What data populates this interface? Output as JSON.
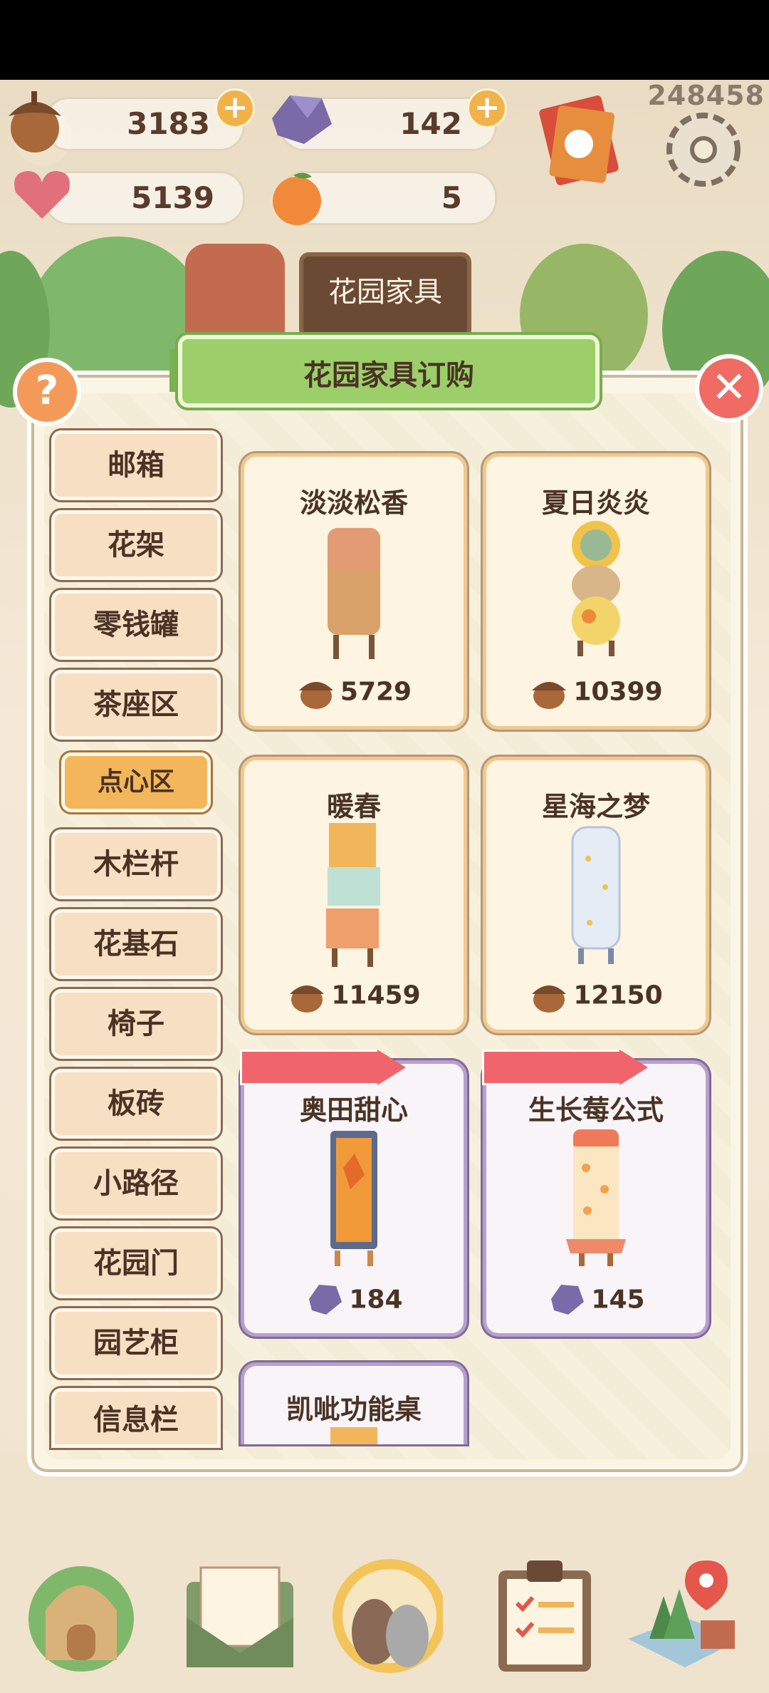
{
  "resources": {
    "acorn": "3183",
    "gem": "142",
    "heart": "5139",
    "orange": "5",
    "score": "248458"
  },
  "background_sign": "花园家具",
  "dialog": {
    "title": "花园家具订购"
  },
  "categories": [
    "邮箱",
    "花架",
    "零钱罐",
    "茶座区",
    "点心区",
    "木栏杆",
    "花基石",
    "椅子",
    "板砖",
    "小路径",
    "花园门",
    "园艺柜",
    "信息栏"
  ],
  "active_category": "点心区",
  "items": [
    {
      "name": "淡淡松香",
      "price": "5729",
      "currency": "acorn"
    },
    {
      "name": "夏日炎炎",
      "price": "10399",
      "currency": "acorn"
    },
    {
      "name": "暖春",
      "price": "11459",
      "currency": "acorn"
    },
    {
      "name": "星海之梦",
      "price": "12150",
      "currency": "acorn"
    },
    {
      "name": "奥田甜心",
      "price": "184",
      "currency": "gem"
    },
    {
      "name": "生长莓公式",
      "price": "145",
      "currency": "gem"
    },
    {
      "name": "凯呲功能桌",
      "price": "",
      "currency": "gem"
    }
  ],
  "colors": {
    "panel_bg": "#fbf5e6",
    "category_bg": "#f6dfc2",
    "category_active": "#f3b65a",
    "card_border": "#f0c98e",
    "special_card_border": "#b79fd0",
    "ribbon": "#9ccf6a",
    "close": "#ef6b63",
    "help": "#f39a58"
  },
  "icons": [
    "acorn-icon",
    "gem-icon",
    "heart-icon",
    "orange-icon",
    "plus-icon",
    "gear-icon",
    "letters-icon",
    "question-icon",
    "close-icon",
    "home-icon",
    "mail-icon",
    "dogs-icon",
    "clipboard-icon",
    "map-icon"
  ]
}
